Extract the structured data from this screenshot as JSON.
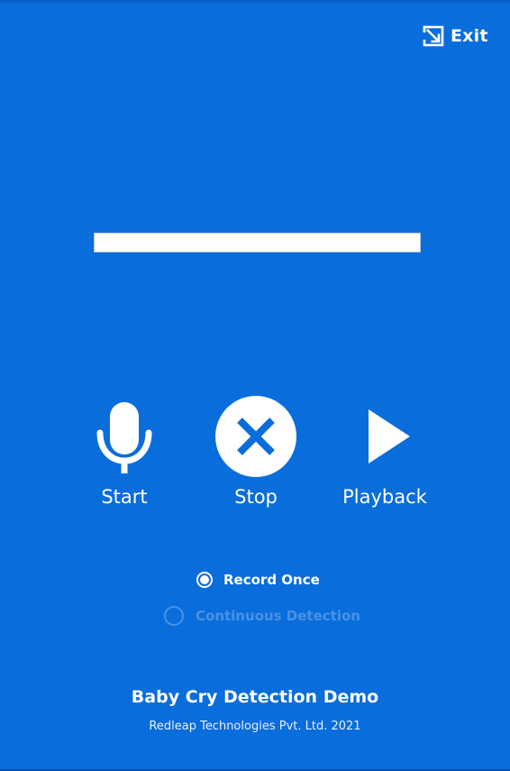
{
  "header": {
    "exit_label": "Exit",
    "exit_icon": "exit-icon"
  },
  "progress": {
    "value_percent": 0
  },
  "controls": [
    {
      "label": "Start",
      "icon": "microphone-icon"
    },
    {
      "label": "Stop",
      "icon": "close-circle-icon"
    },
    {
      "label": "Playback",
      "icon": "play-icon"
    }
  ],
  "mode": {
    "options": [
      {
        "label": "Record Once",
        "selected": true
      },
      {
        "label": "Continuous Detection",
        "selected": false
      }
    ]
  },
  "footer": {
    "title": "Baby Cry Detection Demo",
    "subtitle": "Redleap Technologies Pvt. Ltd. 2021"
  },
  "colors": {
    "background": "#0a6ddc",
    "foreground": "#ffffff"
  }
}
